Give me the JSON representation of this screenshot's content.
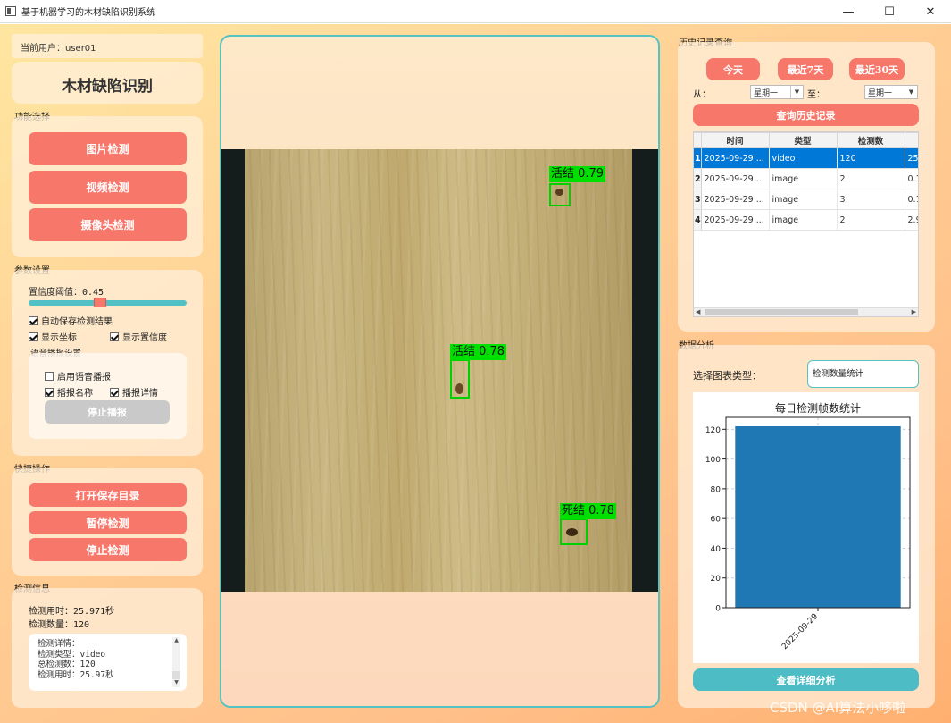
{
  "window": {
    "title": "基于机器学习的木材缺陷识别系统",
    "minimize": "—",
    "maximize": "☐",
    "close": "✕"
  },
  "left": {
    "current_user": "当前用户：user01",
    "title": "木材缺陷识别",
    "function_section": "功能选择",
    "buttons": [
      "图片检测",
      "视频检测",
      "摄像头检测"
    ],
    "param_section": "参数设置",
    "confidence_label": "置信度阈值：0.45",
    "confidence_value": 0.45,
    "auto_save": "自动保存检测结果",
    "show_coords": "显示坐标",
    "show_conf": "显示置信度",
    "voice_section": "语音播报设置",
    "enable_voice": "启用语音播报",
    "announce_name": "播报名称",
    "announce_detail": "播报详情",
    "stop_announce": "停止播报",
    "quick_section": "快捷操作",
    "quick_buttons": [
      "打开保存目录",
      "暂停检测",
      "停止检测"
    ],
    "info_section": "检测信息",
    "time_used": "检测用时：25.971秒",
    "count": "检测数量：120",
    "detail_lines": [
      "检测详情：",
      "检测类型：video",
      "总检测数：120",
      "检测用时：25.97秒"
    ]
  },
  "detections": [
    {
      "label": "活结 0.79"
    },
    {
      "label": "活结 0.78"
    },
    {
      "label": "死结 0.78"
    }
  ],
  "history": {
    "section": "历史记录查询",
    "quick_ranges": [
      "今天",
      "最近7天",
      "最近30天"
    ],
    "from_label": "从：",
    "from_value": "星期一",
    "to_label": "至：",
    "to_value": "星期一",
    "query_button": "查询历史记录",
    "columns": [
      "时间",
      "类型",
      "检测数",
      ""
    ],
    "rows": [
      {
        "n": "1",
        "time": "2025-09-29 ...",
        "type": "video",
        "count": "120",
        "extra": "25."
      },
      {
        "n": "2",
        "time": "2025-09-29 ...",
        "type": "image",
        "count": "2",
        "extra": "0.1"
      },
      {
        "n": "3",
        "time": "2025-09-29 ...",
        "type": "image",
        "count": "3",
        "extra": "0.1"
      },
      {
        "n": "4",
        "time": "2025-09-29 ...",
        "type": "image",
        "count": "2",
        "extra": "2.9"
      }
    ]
  },
  "analysis": {
    "section": "数据分析",
    "chart_type_label": "选择图表类型：",
    "chart_type_value": "检测数量统计",
    "detail_button": "查看详细分析"
  },
  "chart_data": {
    "type": "bar",
    "title": "每日检测帧数统计",
    "categories": [
      "2025-09-29"
    ],
    "values": [
      122
    ],
    "ylim": [
      0,
      128
    ],
    "yticks": [
      0,
      20,
      40,
      60,
      80,
      100,
      120
    ],
    "grid": true,
    "color": "#1f77b4"
  },
  "watermark": "CSDN @AI算法小哆啦"
}
